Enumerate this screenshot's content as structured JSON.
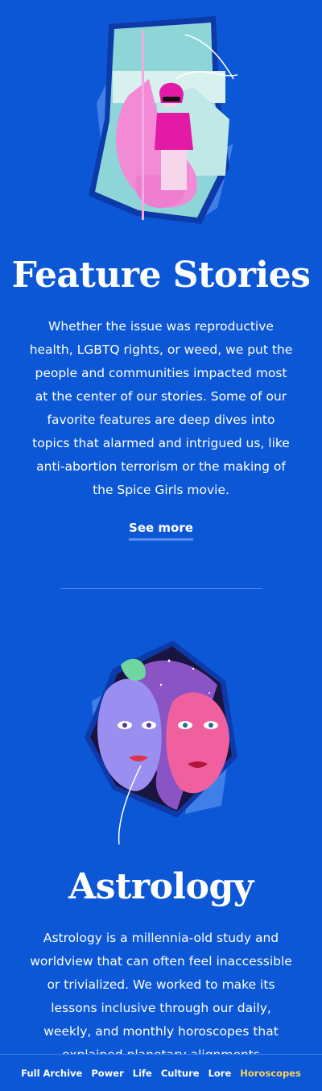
{
  "feature": {
    "title": "Feature Stories",
    "body": "Whether the issue was reproductive health, LGBTQ rights, or weed, we put the people and communities impacted most at the center of our stories. Some of our favorite features are deep dives into topics that alarmed and intrigued us, like anti-abortion terrorism or the making of the Spice Girls movie.",
    "link": "See more"
  },
  "astrology": {
    "title": "Astrology",
    "body": "Astrology is a millennia-old study and worldview that can often feel inaccessible or trivialized. We worked to make its lessons inclusive through our daily, weekly, and monthly horoscopes that explained planetary alignments"
  },
  "nav": {
    "items": [
      "Full Archive",
      "Power",
      "Life",
      "Culture",
      "Lore",
      "Horoscopes"
    ],
    "active": "Horoscopes"
  },
  "colors": {
    "background": "#0b57d5",
    "accent": "#f4d35e",
    "link_underline": "#5b8ff0"
  }
}
